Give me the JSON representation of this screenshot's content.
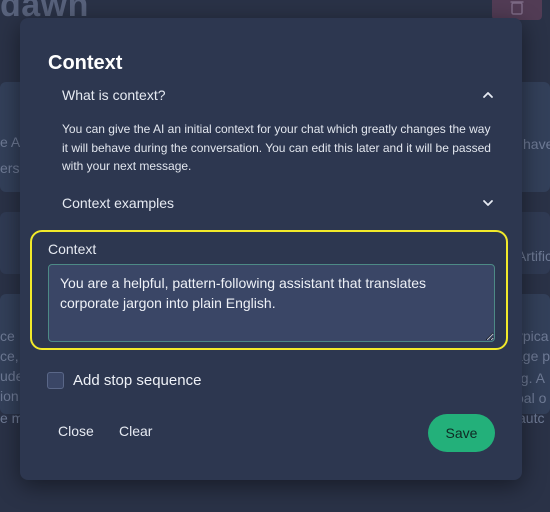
{
  "background": {
    "app_title": "dawn",
    "fragments": [
      "e A",
      "ers",
      "have",
      "Artific",
      "ce",
      "ce,",
      "ude",
      "ion",
      "e ma",
      "typica",
      "age p",
      "ng. A",
      "oal o",
      "autc"
    ]
  },
  "modal": {
    "title": "Context",
    "accordion": [
      {
        "label": "What is context?",
        "expanded": true,
        "body": "You can give the AI an initial context for your chat which greatly changes the way it will behave during the conversation. You can edit this later and it will be passed with your next message."
      },
      {
        "label": "Context examples",
        "expanded": false
      }
    ],
    "context_field": {
      "label": "Context",
      "value": "You are a helpful, pattern-following assistant that translates corporate jargon into plain English."
    },
    "stop_sequence": {
      "label": "Add stop sequence",
      "checked": false
    },
    "buttons": {
      "close": "Close",
      "clear": "Clear",
      "save": "Save"
    }
  },
  "colors": {
    "accent": "#23b07a",
    "highlight": "#f2ea2a",
    "modal_bg": "#2d3750",
    "input_border": "#4d8a86"
  }
}
